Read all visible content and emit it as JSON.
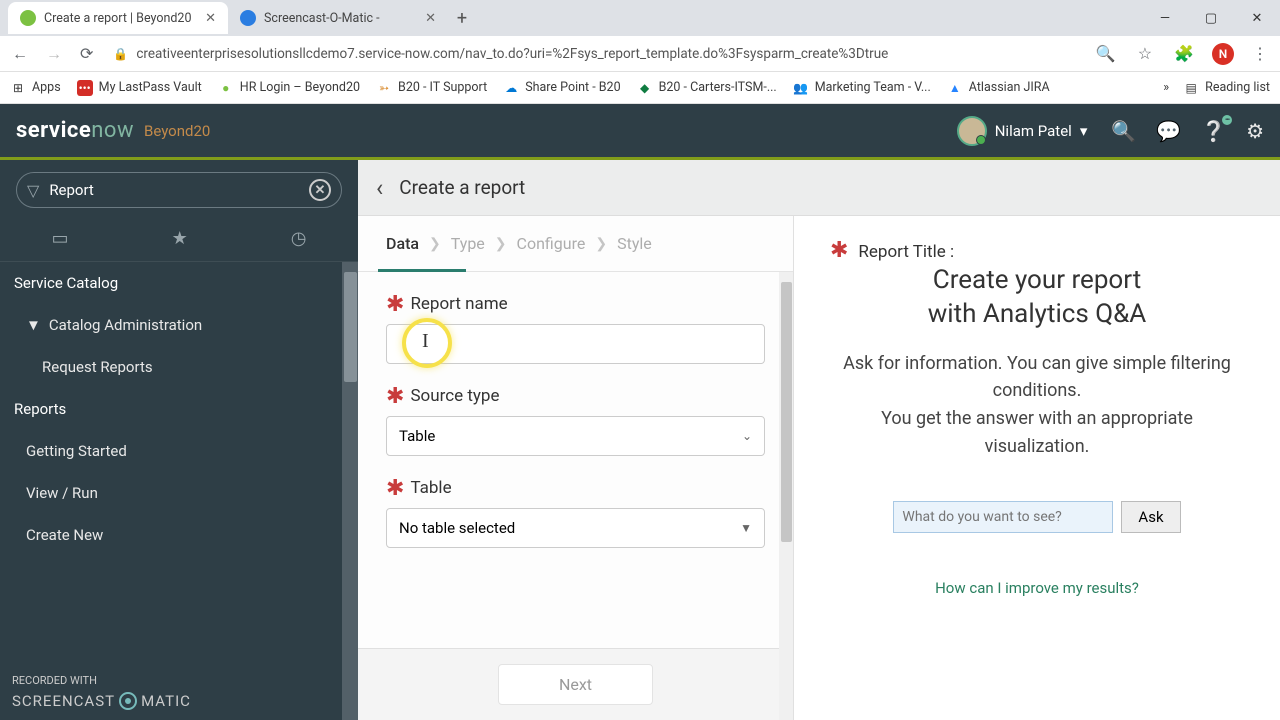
{
  "browser": {
    "tabs": [
      {
        "title": "Create a report | Beyond20",
        "active": true
      },
      {
        "title": "Screencast-O-Matic -",
        "active": false
      }
    ],
    "url": "creativeenterprisesolutionsllcdemo7.service-now.com/nav_to.do?uri=%2Fsys_report_template.do%3Fsysparm_create%3Dtrue",
    "avatar_letter": "N",
    "bookmarks": {
      "apps": "Apps",
      "items": [
        "My LastPass Vault",
        "HR Login – Beyond20",
        "B20 - IT Support",
        "Share Point - B20",
        "B20 - Carters-ITSM-...",
        "Marketing Team - V...",
        "Atlassian JIRA"
      ],
      "more": "»",
      "reading_list": "Reading list"
    }
  },
  "sn_header": {
    "logo_a": "service",
    "logo_b": "now",
    "instance": "Beyond20",
    "user": "Nilam Patel"
  },
  "nav": {
    "filter_value": "Report",
    "items": {
      "service_catalog": "Service Catalog",
      "catalog_admin": "Catalog Administration",
      "request_reports": "Request Reports",
      "reports": "Reports",
      "getting_started": "Getting Started",
      "view_run": "View / Run",
      "create_new": "Create New"
    }
  },
  "page": {
    "title": "Create a report",
    "wizard": {
      "data": "Data",
      "type": "Type",
      "configure": "Configure",
      "style": "Style"
    },
    "form": {
      "report_name_label": "Report name",
      "report_name_value": "",
      "source_type_label": "Source type",
      "source_type_value": "Table",
      "table_label": "Table",
      "table_value": "No table selected"
    },
    "next": "Next"
  },
  "right_panel": {
    "report_title_label": "Report Title :",
    "heading_l1": "Create your report",
    "heading_l2": "with Analytics Q&A",
    "body_p1": "Ask for information. You can give simple filtering conditions.",
    "body_p2": "You get the answer with an appropriate visualization.",
    "qa_placeholder": "What do you want to see?",
    "ask": "Ask",
    "improve_link": "How can I improve my results?"
  },
  "recorder": {
    "line1": "RECORDED WITH",
    "brand_a": "SCREENCAST",
    "brand_b": "MATIC"
  }
}
